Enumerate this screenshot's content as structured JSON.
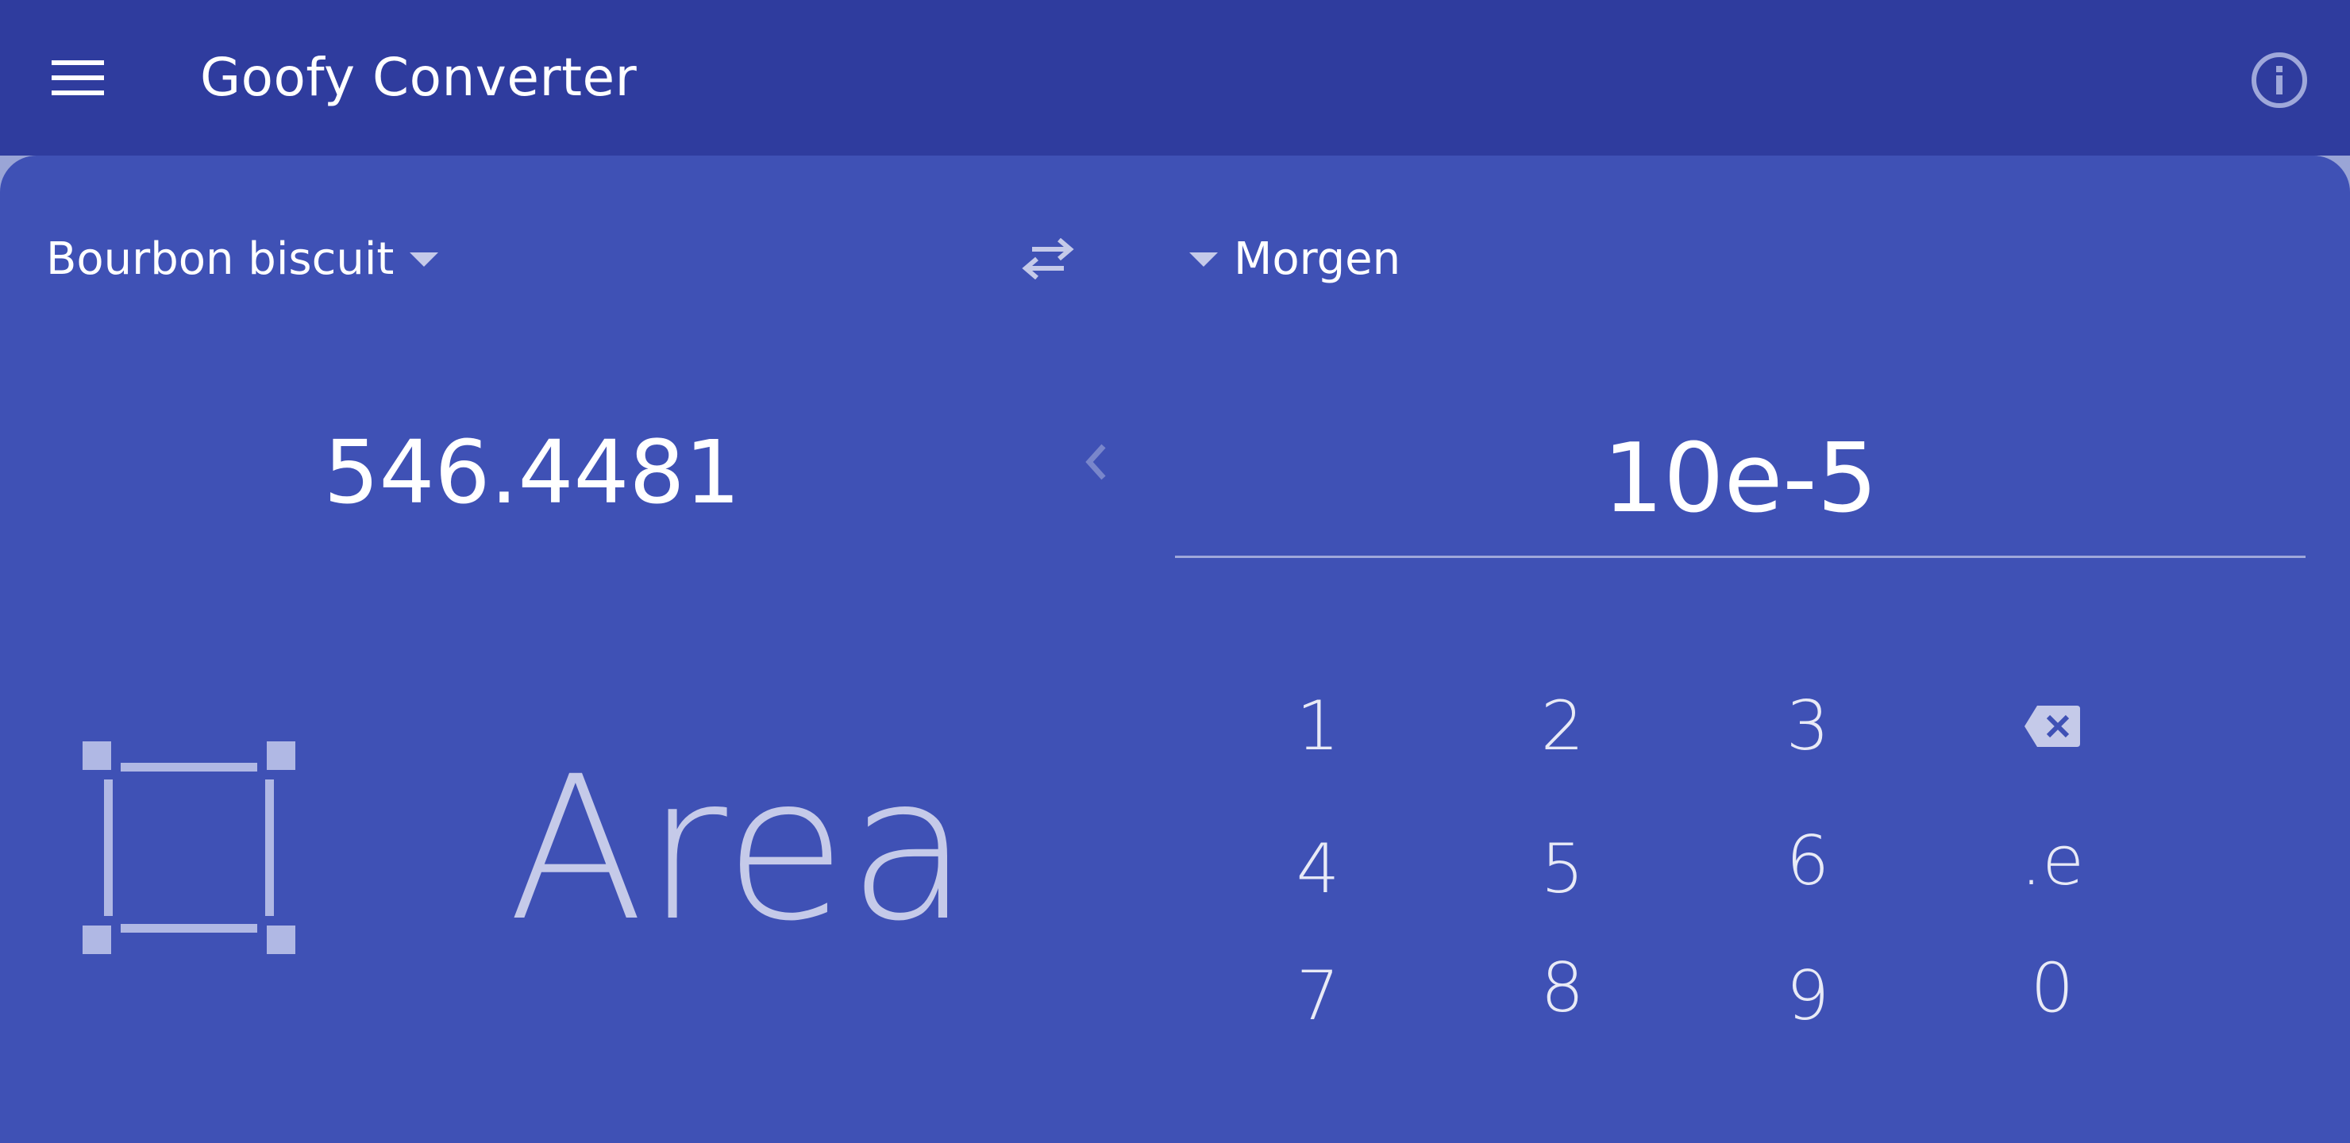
{
  "colors": {
    "appbar": "#2f3c9e",
    "sheet": "#3f51b5",
    "accent_light": "#c5cae9",
    "text": "#ffffff"
  },
  "appbar": {
    "menu_icon": "hamburger-menu-icon",
    "title": "Goofy Converter",
    "info_icon": "info-circle-icon"
  },
  "converter": {
    "from_unit": "Bourbon biscuit",
    "to_unit": "Morgen",
    "swap_icon": "swap-arrows-icon",
    "output_value": "546.4481",
    "collapse_icon": "chevron-left-icon",
    "input_value": "10e-5"
  },
  "category": {
    "icon": "area-square-icon",
    "label": "Area"
  },
  "keypad": {
    "keys": [
      "1",
      "2",
      "3",
      "4",
      "5",
      "6",
      ".e",
      "7",
      "8",
      "9",
      "0"
    ],
    "backspace_icon": "backspace-icon"
  }
}
